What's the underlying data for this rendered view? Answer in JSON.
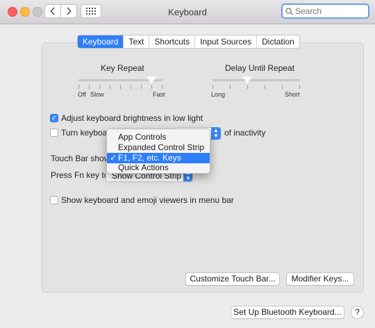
{
  "window": {
    "title": "Keyboard"
  },
  "search": {
    "placeholder": "Search"
  },
  "tabs": [
    "Keyboard",
    "Text",
    "Shortcuts",
    "Input Sources",
    "Dictation"
  ],
  "key_repeat": {
    "label": "Key Repeat",
    "scale": [
      "Off",
      "Slow",
      "Fast"
    ],
    "level": 0.87
  },
  "delay_repeat": {
    "label": "Delay Until Repeat",
    "scale": [
      "Long",
      "Short"
    ],
    "level": 0.4
  },
  "options": {
    "adjust_brightness": {
      "label": "Adjust keyboard brightness in low light",
      "checked": true
    },
    "turn_off": {
      "label_prefix": "Turn keyboard",
      "label_suffix": "of inactivity",
      "checked": false
    },
    "touch_bar_shows": {
      "label": "Touch Bar shows"
    },
    "press_fn": {
      "label": "Press Fn key to",
      "value": "Show Control Strip"
    },
    "show_viewers": {
      "label": "Show keyboard and emoji viewers in menu bar",
      "checked": false
    }
  },
  "dropdown": {
    "items": [
      "App Controls",
      "Expanded Control Strip",
      "F1, F2, etc. Keys",
      "Quick Actions"
    ],
    "selected_index": 2,
    "check_mark": "✓"
  },
  "buttons": {
    "customize": "Customize Touch Bar...",
    "modifier": "Modifier Keys...",
    "bluetooth": "Set Up Bluetooth Keyboard...",
    "help": "?"
  },
  "colors": {
    "accent": "#2f7ff6"
  },
  "icons": {
    "back": "chevron-left-icon",
    "forward": "chevron-right-icon",
    "grid": "grid-icon",
    "search": "magnifier-icon"
  }
}
